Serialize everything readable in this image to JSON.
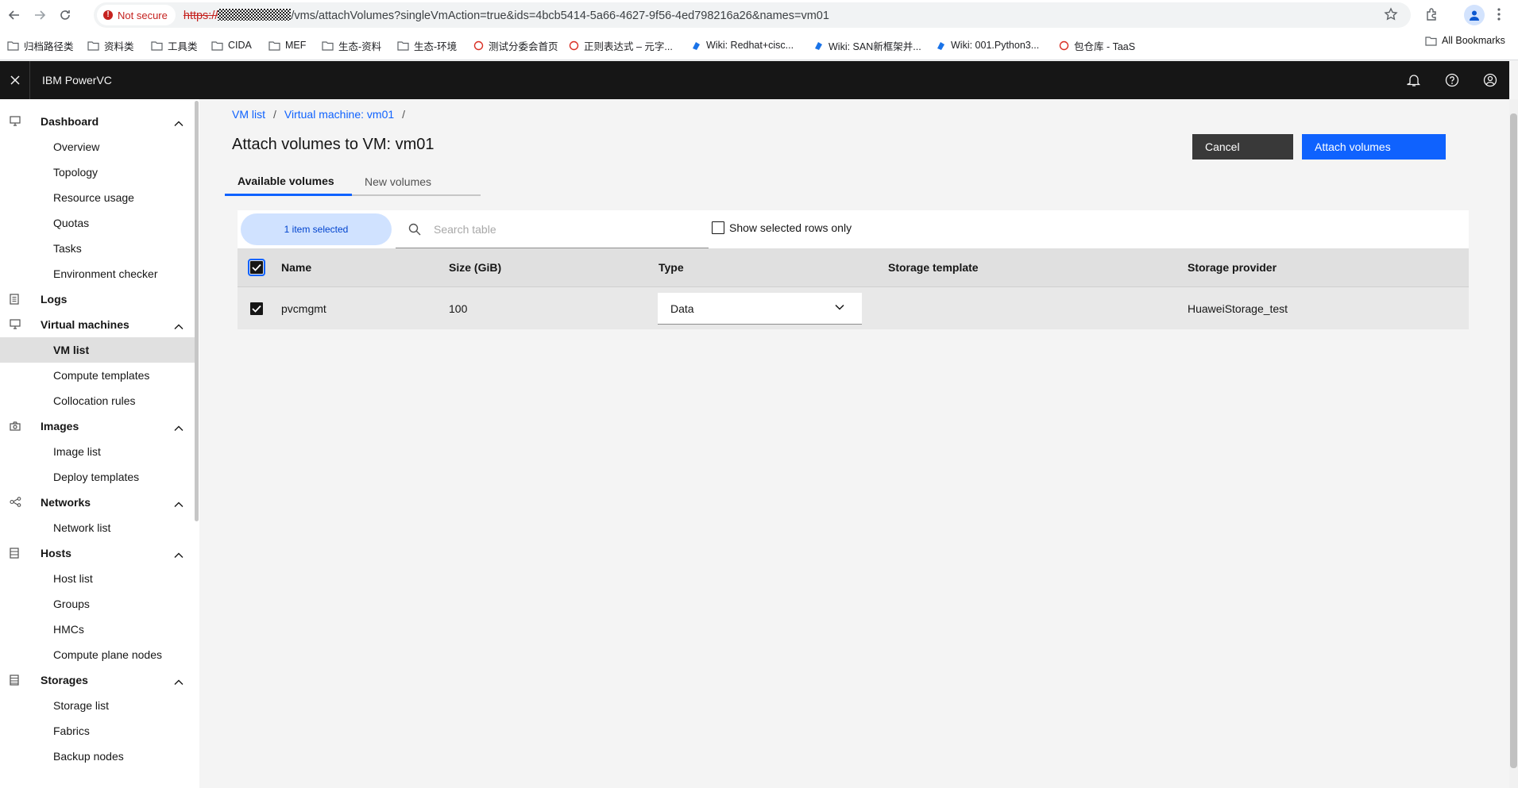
{
  "browser": {
    "not_secure": "Not secure",
    "url_scheme": "https://",
    "url_rest": "/vms/attachVolumes?singleVmAction=true&ids=4bcb5414-5a66-4627-9f56-4ed798216a26&names=vm01",
    "bookmarks": [
      {
        "label": "归档路径类",
        "icon": "folder-icon"
      },
      {
        "label": "资料类",
        "icon": "folder-icon"
      },
      {
        "label": "工具类",
        "icon": "folder-icon"
      },
      {
        "label": "CIDA",
        "icon": "folder-icon"
      },
      {
        "label": "MEF",
        "icon": "folder-icon"
      },
      {
        "label": "生态-资料",
        "icon": "folder-icon"
      },
      {
        "label": "生态-环境",
        "icon": "folder-icon"
      },
      {
        "label": "测试分委会首页",
        "icon": "site-icon"
      },
      {
        "label": "正则表达式 – 元字...",
        "icon": "site-icon"
      },
      {
        "label": "Wiki: Redhat+cisc...",
        "icon": "wiki-icon"
      },
      {
        "label": "Wiki: SAN新框架并...",
        "icon": "wiki-icon"
      },
      {
        "label": "Wiki: 001.Python3...",
        "icon": "wiki-icon"
      },
      {
        "label": "包仓库 - TaaS",
        "icon": "site-icon"
      }
    ],
    "all_bookmarks": "All Bookmarks"
  },
  "header": {
    "brand": "IBM PowerVC"
  },
  "sidebar": {
    "items": [
      {
        "label": "Dashboard",
        "type": "head",
        "icon": "monitor-icon",
        "chevron": true
      },
      {
        "label": "Overview",
        "type": "sub"
      },
      {
        "label": "Topology",
        "type": "sub"
      },
      {
        "label": "Resource usage",
        "type": "sub"
      },
      {
        "label": "Quotas",
        "type": "sub"
      },
      {
        "label": "Tasks",
        "type": "sub"
      },
      {
        "label": "Environment checker",
        "type": "sub"
      },
      {
        "label": "Logs",
        "type": "head",
        "icon": "document-icon",
        "chevron": false
      },
      {
        "label": "Virtual machines",
        "type": "head",
        "icon": "monitor-icon",
        "chevron": true
      },
      {
        "label": "VM list",
        "type": "sub",
        "active": true
      },
      {
        "label": "Compute templates",
        "type": "sub"
      },
      {
        "label": "Collocation rules",
        "type": "sub"
      },
      {
        "label": "Images",
        "type": "head",
        "icon": "camera-icon",
        "chevron": true
      },
      {
        "label": "Image list",
        "type": "sub"
      },
      {
        "label": "Deploy templates",
        "type": "sub"
      },
      {
        "label": "Networks",
        "type": "head",
        "icon": "network-icon",
        "chevron": true
      },
      {
        "label": "Network list",
        "type": "sub"
      },
      {
        "label": "Hosts",
        "type": "head",
        "icon": "server-icon",
        "chevron": true
      },
      {
        "label": "Host list",
        "type": "sub"
      },
      {
        "label": "Groups",
        "type": "sub"
      },
      {
        "label": "HMCs",
        "type": "sub"
      },
      {
        "label": "Compute plane nodes",
        "type": "sub"
      },
      {
        "label": "Storages",
        "type": "head",
        "icon": "storage-icon",
        "chevron": true
      },
      {
        "label": "Storage list",
        "type": "sub"
      },
      {
        "label": "Fabrics",
        "type": "sub"
      },
      {
        "label": "Backup nodes",
        "type": "sub"
      }
    ]
  },
  "breadcrumb": {
    "item1": "VM list",
    "item2": "Virtual machine: vm01",
    "sep": "/"
  },
  "page": {
    "title": "Attach volumes to VM: vm01",
    "cancel": "Cancel",
    "attach": "Attach volumes",
    "tab_available": "Available volumes",
    "tab_new": "New volumes"
  },
  "toolbar": {
    "selected_count": "1 item selected",
    "search_placeholder": "Search table",
    "show_selected": "Show selected rows only"
  },
  "table": {
    "headers": {
      "name": "Name",
      "size": "Size (GiB)",
      "type": "Type",
      "template": "Storage template",
      "provider": "Storage provider"
    },
    "rows": [
      {
        "name": "pvcmgmt",
        "size": "100",
        "type": "Data",
        "template": "",
        "provider": "HuaweiStorage_test",
        "selected": true
      }
    ]
  },
  "colors": {
    "primary": "#0f62fe",
    "header_bg": "#161616",
    "cancel_bg": "#393939",
    "selected_pill": "#d0e2ff"
  }
}
